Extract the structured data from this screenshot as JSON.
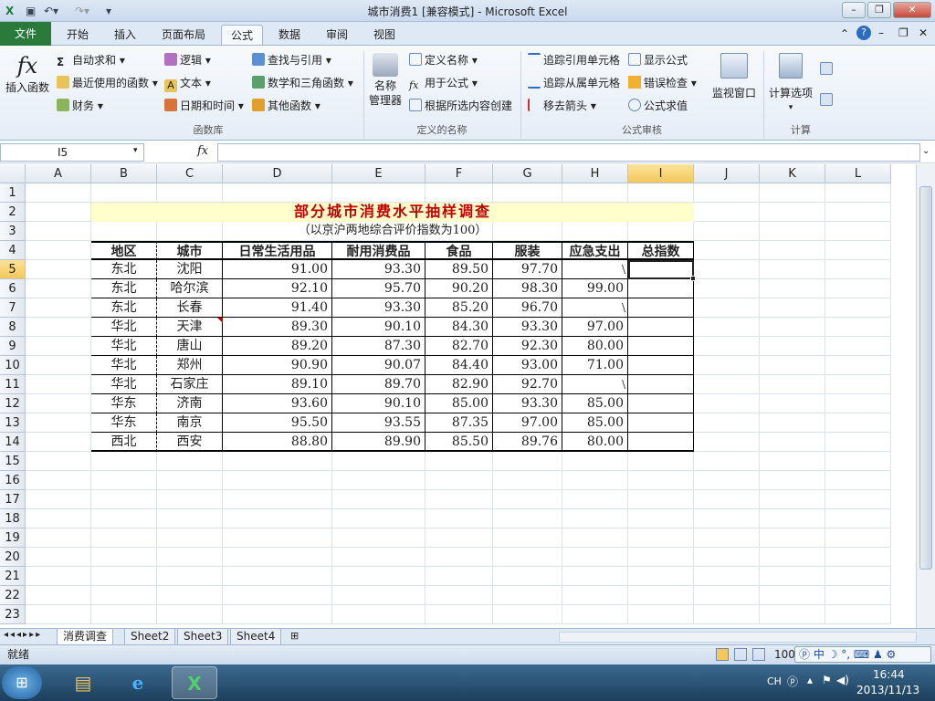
{
  "window": {
    "title": "城市消费1  [兼容模式] - Microsoft Excel"
  },
  "quick_access": {
    "save_icon": "save-icon",
    "undo_icon": "undo-icon",
    "redo_icon": "redo-icon"
  },
  "tabs": [
    {
      "label": "文件"
    },
    {
      "label": "开始"
    },
    {
      "label": "插入"
    },
    {
      "label": "页面布局"
    },
    {
      "label": "公式"
    },
    {
      "label": "数据"
    },
    {
      "label": "审阅"
    },
    {
      "label": "视图"
    }
  ],
  "ribbon": {
    "insert_function": "插入函数",
    "funclib": {
      "autosum": "自动求和",
      "recent": "最近使用的函数",
      "finance": "财务",
      "logic": "逻辑",
      "text": "文本",
      "datetime": "日期和时间",
      "lookup": "查找与引用",
      "math": "数学和三角函数",
      "other": "其他函数",
      "group": "函数库"
    },
    "names": {
      "manager_1": "名称",
      "manager_2": "管理器",
      "define": "定义名称",
      "use_in": "用于公式",
      "create": "根据所选内容创建",
      "group": "定义的名称"
    },
    "audit": {
      "trace_prec": "追踪引用单元格",
      "trace_dep": "追踪从属单元格",
      "remove": "移去箭头",
      "show": "显示公式",
      "check": "错误检查",
      "eval": "公式求值",
      "watch": "监视窗口",
      "group": "公式审核"
    },
    "calc": {
      "options": "计算选项",
      "group": "计算"
    }
  },
  "formula_bar": {
    "name_box": "I5",
    "fx": "fx",
    "value": ""
  },
  "columns": [
    "A",
    "B",
    "C",
    "D",
    "E",
    "F",
    "G",
    "H",
    "I",
    "J",
    "K",
    "L"
  ],
  "rows": [
    "1",
    "2",
    "3",
    "4",
    "5",
    "6",
    "7",
    "8",
    "9",
    "10",
    "11",
    "12",
    "13",
    "14",
    "15",
    "16",
    "17",
    "18",
    "19",
    "20",
    "21",
    "22",
    "23"
  ],
  "sheet": {
    "title": "部分城市消费水平抽样调查",
    "subtitle": "（以京沪两地综合评价指数为100）",
    "headers": [
      "地区",
      "城市",
      "日常生活用品",
      "耐用消费品",
      "食品",
      "服装",
      "应急支出",
      "总指数"
    ],
    "data": [
      [
        "东北",
        "沈阳",
        "91.00",
        "93.30",
        "89.50",
        "97.70",
        "",
        ""
      ],
      [
        "东北",
        "哈尔滨",
        "92.10",
        "95.70",
        "90.20",
        "98.30",
        "99.00",
        ""
      ],
      [
        "东北",
        "长春",
        "91.40",
        "93.30",
        "85.20",
        "96.70",
        "",
        ""
      ],
      [
        "华北",
        "天津",
        "89.30",
        "90.10",
        "84.30",
        "93.30",
        "97.00",
        ""
      ],
      [
        "华北",
        "唐山",
        "89.20",
        "87.30",
        "82.70",
        "92.30",
        "80.00",
        ""
      ],
      [
        "华北",
        "郑州",
        "90.90",
        "90.07",
        "84.40",
        "93.00",
        "71.00",
        ""
      ],
      [
        "华北",
        "石家庄",
        "89.10",
        "89.70",
        "82.90",
        "92.70",
        "",
        ""
      ],
      [
        "华东",
        "济南",
        "93.60",
        "90.10",
        "85.00",
        "93.30",
        "85.00",
        ""
      ],
      [
        "华东",
        "南京",
        "95.50",
        "93.55",
        "87.35",
        "97.00",
        "85.00",
        ""
      ],
      [
        "西北",
        "西安",
        "88.80",
        "89.90",
        "85.50",
        "89.76",
        "80.00",
        ""
      ]
    ]
  },
  "sheet_tabs": [
    "消费调查",
    "Sheet2",
    "Sheet3",
    "Sheet4"
  ],
  "status": {
    "ready": "就绪",
    "zoom": "100"
  },
  "taskbar": {
    "lang": "CH",
    "time": "16:44",
    "date": "2013/11/13"
  },
  "colors": {
    "title_red": "#c00000",
    "title_fill": "#ffffcc",
    "file_tab": "#2a7a3b",
    "selected_header": "#f5c75c"
  }
}
